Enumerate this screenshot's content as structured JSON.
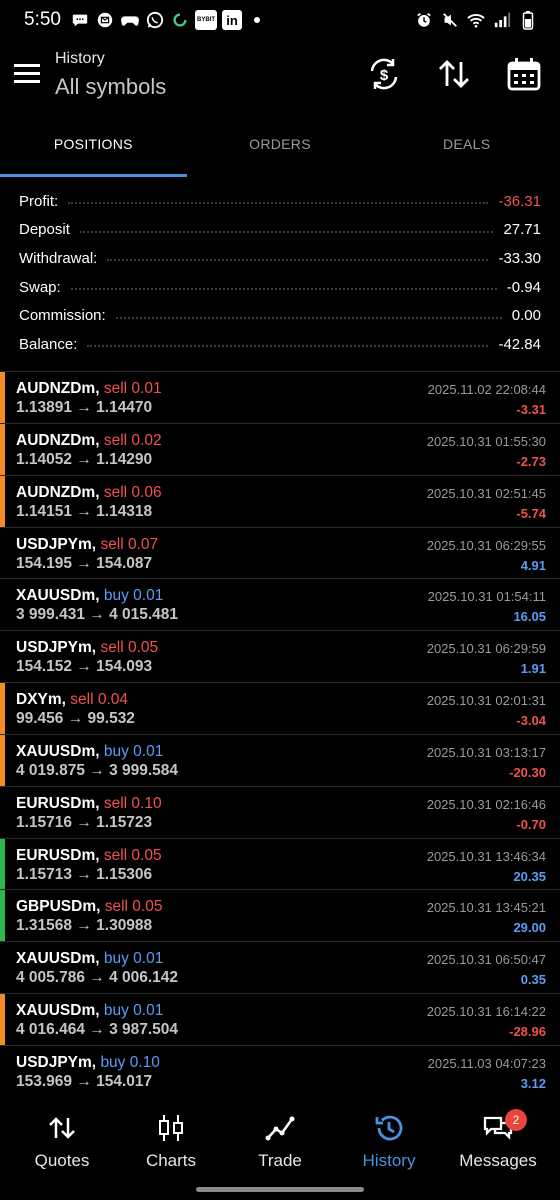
{
  "status": {
    "time": "5:50",
    "left_icons": [
      "chat-bubble-icon",
      "email-icon",
      "game-controller-icon",
      "whatsapp-icon",
      "sync-icon",
      "bybit-icon",
      "linkedin-icon",
      "dot-icon"
    ],
    "right_icons": [
      "alarm-icon",
      "mute-icon",
      "wifi-icon",
      "signal-icon",
      "battery-icon"
    ],
    "bybit_text": "BYBIT",
    "linkedin_text": "in"
  },
  "header": {
    "subtitle": "History",
    "title": "All symbols"
  },
  "tabs": [
    {
      "label": "POSITIONS",
      "active": true
    },
    {
      "label": "ORDERS",
      "active": false
    },
    {
      "label": "DEALS",
      "active": false
    }
  ],
  "summary": [
    {
      "label": "Profit:",
      "value": "-36.31",
      "negative": true
    },
    {
      "label": "Deposit",
      "value": "27.71",
      "negative": false
    },
    {
      "label": "Withdrawal:",
      "value": "-33.30",
      "negative": false
    },
    {
      "label": "Swap:",
      "value": "-0.94",
      "negative": false
    },
    {
      "label": "Commission:",
      "value": "0.00",
      "negative": false
    },
    {
      "label": "Balance:",
      "value": "-42.84",
      "negative": false
    }
  ],
  "deals": [
    {
      "symbol": "AUDNZDm,",
      "type": "sell 0.01",
      "side": "sell",
      "prices": "1.13891 → 1.14470",
      "time": "2025.11.02 22:08:44",
      "profit": "-3.31",
      "bar": "#f28c28"
    },
    {
      "symbol": "AUDNZDm,",
      "type": "sell 0.02",
      "side": "sell",
      "prices": "1.14052 → 1.14290",
      "time": "2025.10.31 01:55:30",
      "profit": "-2.73",
      "bar": "#f28c28"
    },
    {
      "symbol": "AUDNZDm,",
      "type": "sell 0.06",
      "side": "sell",
      "prices": "1.14151 → 1.14318",
      "time": "2025.10.31 02:51:45",
      "profit": "-5.74",
      "bar": "#f28c28"
    },
    {
      "symbol": "USDJPYm,",
      "type": "sell 0.07",
      "side": "sell",
      "prices": "154.195 → 154.087",
      "time": "2025.10.31 06:29:55",
      "profit": "4.91",
      "bar": ""
    },
    {
      "symbol": "XAUUSDm,",
      "type": "buy 0.01",
      "side": "buy",
      "prices": "3 999.431 → 4 015.481",
      "time": "2025.10.31 01:54:11",
      "profit": "16.05",
      "bar": ""
    },
    {
      "symbol": "USDJPYm,",
      "type": "sell 0.05",
      "side": "sell",
      "prices": "154.152 → 154.093",
      "time": "2025.10.31 06:29:59",
      "profit": "1.91",
      "bar": ""
    },
    {
      "symbol": "DXYm,",
      "type": "sell 0.04",
      "side": "sell",
      "prices": "99.456 → 99.532",
      "time": "2025.10.31 02:01:31",
      "profit": "-3.04",
      "bar": "#f28c28"
    },
    {
      "symbol": "XAUUSDm,",
      "type": "buy 0.01",
      "side": "buy",
      "prices": "4 019.875 → 3 999.584",
      "time": "2025.10.31 03:13:17",
      "profit": "-20.30",
      "bar": "#f28c28"
    },
    {
      "symbol": "EURUSDm,",
      "type": "sell 0.10",
      "side": "sell",
      "prices": "1.15716 → 1.15723",
      "time": "2025.10.31 02:16:46",
      "profit": "-0.70",
      "bar": ""
    },
    {
      "symbol": "EURUSDm,",
      "type": "sell 0.05",
      "side": "sell",
      "prices": "1.15713 → 1.15306",
      "time": "2025.10.31 13:46:34",
      "profit": "20.35",
      "bar": "#2db84d"
    },
    {
      "symbol": "GBPUSDm,",
      "type": "sell 0.05",
      "side": "sell",
      "prices": "1.31568 → 1.30988",
      "time": "2025.10.31 13:45:21",
      "profit": "29.00",
      "bar": "#2db84d"
    },
    {
      "symbol": "XAUUSDm,",
      "type": "buy 0.01",
      "side": "buy",
      "prices": "4 005.786 → 4 006.142",
      "time": "2025.10.31 06:50:47",
      "profit": "0.35",
      "bar": ""
    },
    {
      "symbol": "XAUUSDm,",
      "type": "buy 0.01",
      "side": "buy",
      "prices": "4 016.464 → 3 987.504",
      "time": "2025.10.31 16:14:22",
      "profit": "-28.96",
      "bar": "#f28c28"
    },
    {
      "symbol": "USDJPYm,",
      "type": "buy 0.10",
      "side": "buy",
      "prices": "153.969 → 154.017",
      "time": "2025.11.03 04:07:23",
      "profit": "3.12",
      "bar": ""
    }
  ],
  "nav": [
    {
      "label": "Quotes",
      "icon": "quotes-arrows-icon",
      "active": false
    },
    {
      "label": "Charts",
      "icon": "candlestick-icon",
      "active": false
    },
    {
      "label": "Trade",
      "icon": "trade-line-icon",
      "active": false
    },
    {
      "label": "History",
      "icon": "history-clock-icon",
      "active": true
    },
    {
      "label": "Messages",
      "icon": "messages-icon",
      "active": false,
      "badge": "2"
    }
  ],
  "colors": {
    "accent": "#4a90e2",
    "sell": "#f0524e",
    "buy": "#5b9cf5",
    "badge": "#e8453c"
  }
}
